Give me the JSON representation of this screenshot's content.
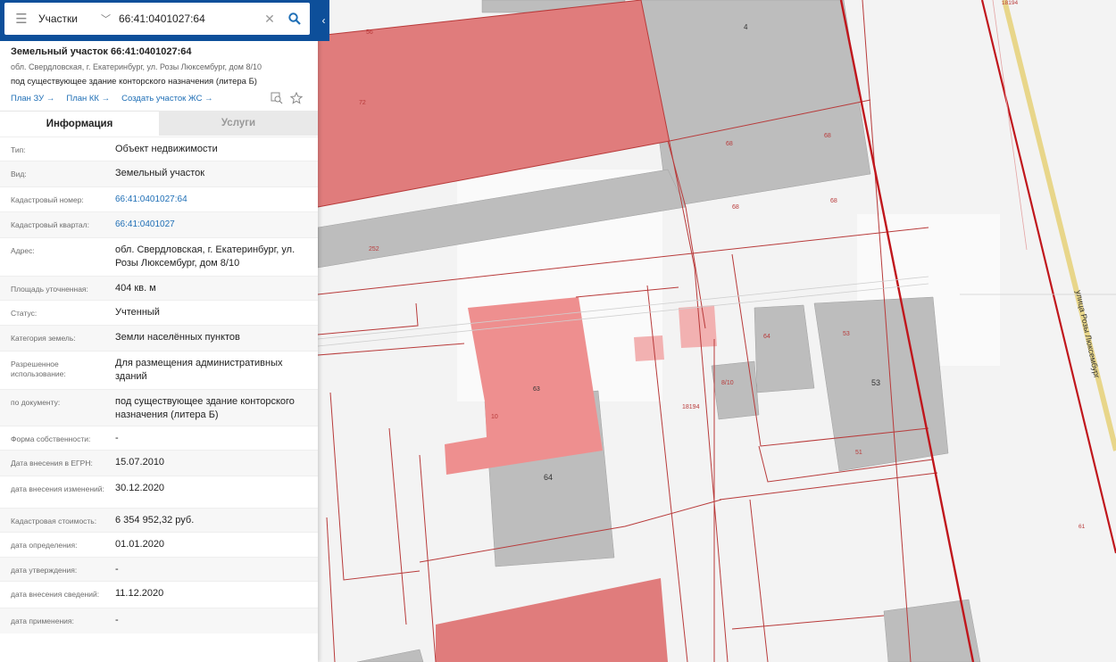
{
  "search": {
    "layer_label": "Участки",
    "query": "66:41:0401027:64"
  },
  "parcel": {
    "title": "Земельный участок 66:41:0401027:64",
    "address_short": "обл. Свердловская, г. Екатеринбург, ул. Розы Люксембург, дом 8/10",
    "purpose": "под существующее здание конторского назначения (литера Б)",
    "links": [
      "План ЗУ →",
      "План КК →",
      "Создать участок ЖС →"
    ]
  },
  "tabs": [
    "Информация",
    "Услуги"
  ],
  "rows": [
    {
      "label": "Тип:",
      "value": "Объект недвижимости"
    },
    {
      "label": "Вид:",
      "value": "Земельный участок"
    },
    {
      "label": "Кадастровый номер:",
      "value": "66:41:0401027:64",
      "link": true
    },
    {
      "label": "Кадастровый квартал:",
      "value": "66:41:0401027",
      "link": true
    },
    {
      "label": "Адрес:",
      "value": "обл. Свердловская, г. Екатеринбург, ул. Розы Люксембург, дом 8/10"
    },
    {
      "label": "Площадь уточненная:",
      "value": "404 кв. м"
    },
    {
      "label": "Статус:",
      "value": "Учтенный"
    },
    {
      "label": "Категория земель:",
      "value": "Земли населённых пунктов"
    },
    {
      "label": "Разрешенное использование:",
      "value": "Для размещения административных зданий"
    },
    {
      "label": "по документу:",
      "value": "под существующее здание конторского назначения (литера Б)"
    },
    {
      "label": "Форма собственности:",
      "value": "-"
    },
    {
      "label": "Дата внесения в ЕГРН:",
      "value": "15.07.2010"
    },
    {
      "label": "дата внесения изменений:",
      "value": "30.12.2020"
    },
    {
      "label": "Кадастровая стоимость:",
      "value": "6 354 952,32 руб."
    },
    {
      "label": "дата определения:",
      "value": "01.01.2020"
    },
    {
      "label": "дата утверждения:",
      "value": "-"
    },
    {
      "label": "дата внесения сведений:",
      "value": "11.12.2020"
    },
    {
      "label": "дата применения:",
      "value": "-"
    }
  ],
  "map": {
    "street_name": "улица Розы Люксембург",
    "parcel_labels": [
      "56",
      "4",
      "72",
      "68",
      "68",
      "68",
      "68",
      "61",
      "252",
      "63",
      "10",
      "64",
      "64",
      "53",
      "8/10",
      "53",
      "51",
      "18194",
      "18194"
    ]
  },
  "colors": {
    "accent": "#0d4f9a",
    "link": "#1f6fb6",
    "parcel_fill": "#e07c7c",
    "parcel_stroke": "#b22222",
    "building": "#bdbdbd"
  }
}
